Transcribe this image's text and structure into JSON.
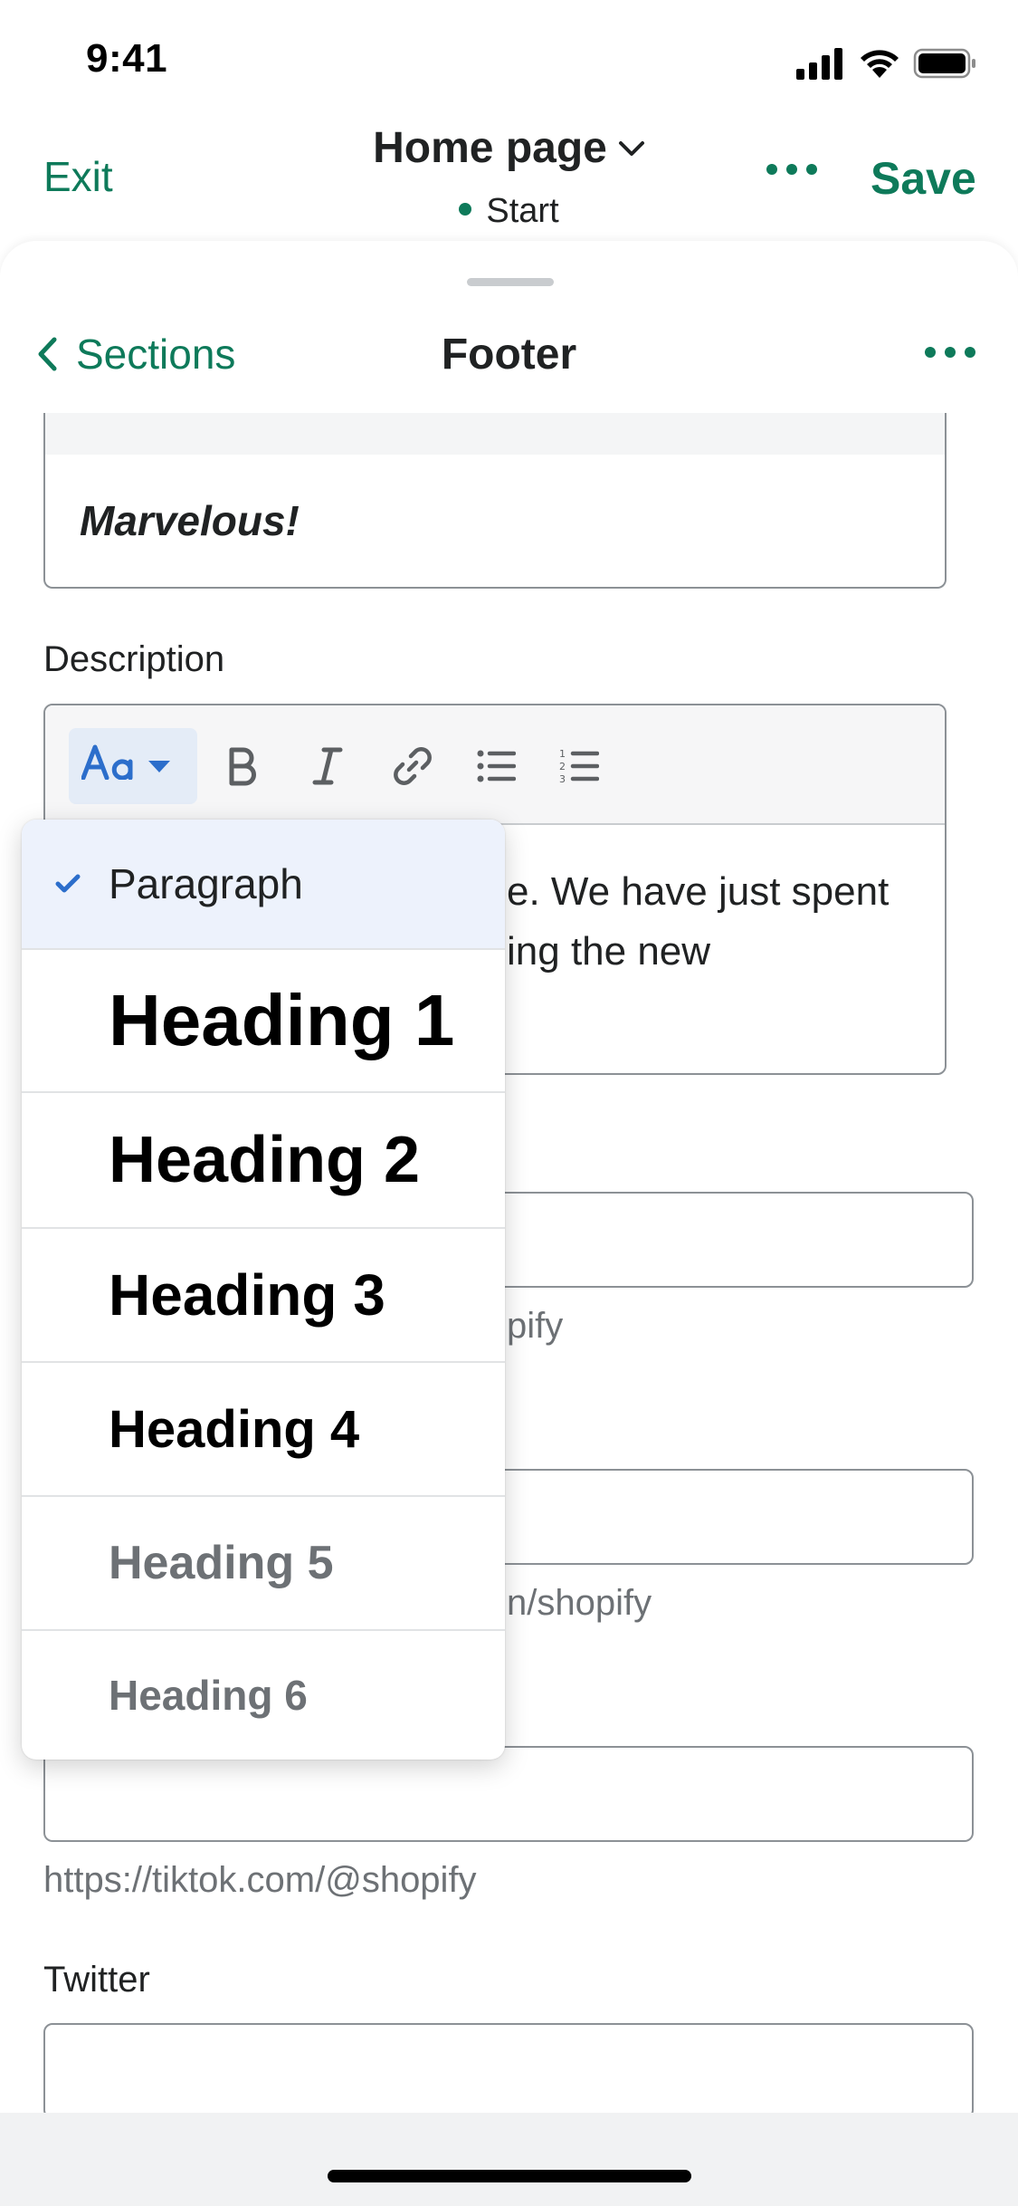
{
  "status_bar": {
    "time": "9:41"
  },
  "header": {
    "exit_label": "Exit",
    "page_title": "Home page",
    "status_label": "Start",
    "save_label": "Save"
  },
  "section_nav": {
    "back_label": "Sections",
    "title": "Footer"
  },
  "content": {
    "heading_text": "Marvelous!",
    "description_label": "Description",
    "description_line1": "e. We have just spent",
    "description_line2": "ing the new"
  },
  "social_fields": [
    {
      "help": "pify"
    },
    {
      "help": "n/shopify"
    },
    {
      "help": "https://tiktok.com/@shopify"
    }
  ],
  "twitter_label": "Twitter",
  "format_dropdown": {
    "selected": "Paragraph",
    "options": [
      "Paragraph",
      "Heading 1",
      "Heading 2",
      "Heading 3",
      "Heading 4",
      "Heading 5",
      "Heading 6"
    ]
  },
  "colors": {
    "accent": "#0e7a5a",
    "editor_accent": "#2c6ecb",
    "selected_bg": "#edf2fc"
  },
  "icons": [
    "signal-icon",
    "wifi-icon",
    "battery-icon",
    "chevron-down-icon",
    "more-horizontal-icon",
    "chevron-left-icon",
    "text-format-icon",
    "bold-icon",
    "italic-icon",
    "link-icon",
    "bullet-list-icon",
    "numbered-list-icon",
    "checkmark-icon"
  ]
}
